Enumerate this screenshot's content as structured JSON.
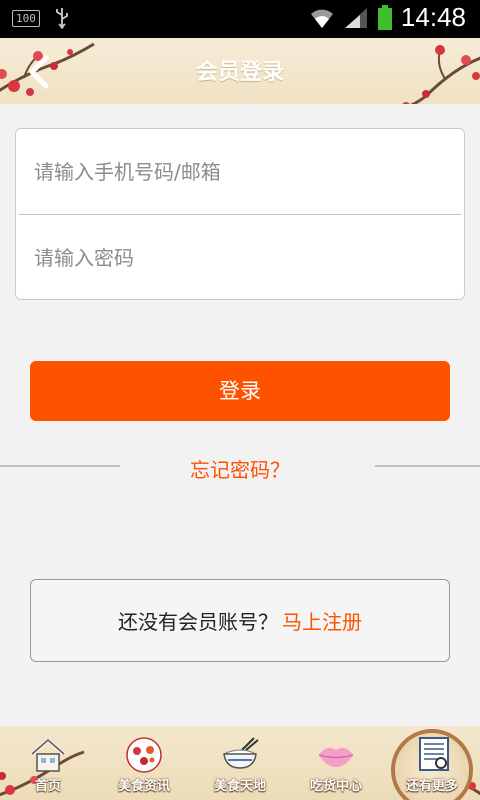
{
  "status_bar": {
    "battery_badge": "100",
    "time": "14:48"
  },
  "header": {
    "title": "会员登录",
    "back_icon": "chevron-left-icon"
  },
  "form": {
    "phone_placeholder": "请输入手机号码/邮箱",
    "phone_value": "",
    "password_placeholder": "请输入密码",
    "password_value": ""
  },
  "login_label": "登录",
  "forgot_label": "忘记密码？",
  "register": {
    "prompt": "还没有会员账号？",
    "link": "马上注册"
  },
  "bottom_nav": [
    {
      "label": "首页",
      "icon": "home-icon"
    },
    {
      "label": "美食资讯",
      "icon": "food-news-icon"
    },
    {
      "label": "美食天地",
      "icon": "rice-bowl-icon"
    },
    {
      "label": "吃货中心",
      "icon": "lips-icon"
    },
    {
      "label": "还有更多",
      "icon": "more-document-icon"
    }
  ],
  "colors": {
    "accent": "#ff5200",
    "header_bg": "#f2e5c8",
    "page_bg": "#f2f2f2"
  }
}
